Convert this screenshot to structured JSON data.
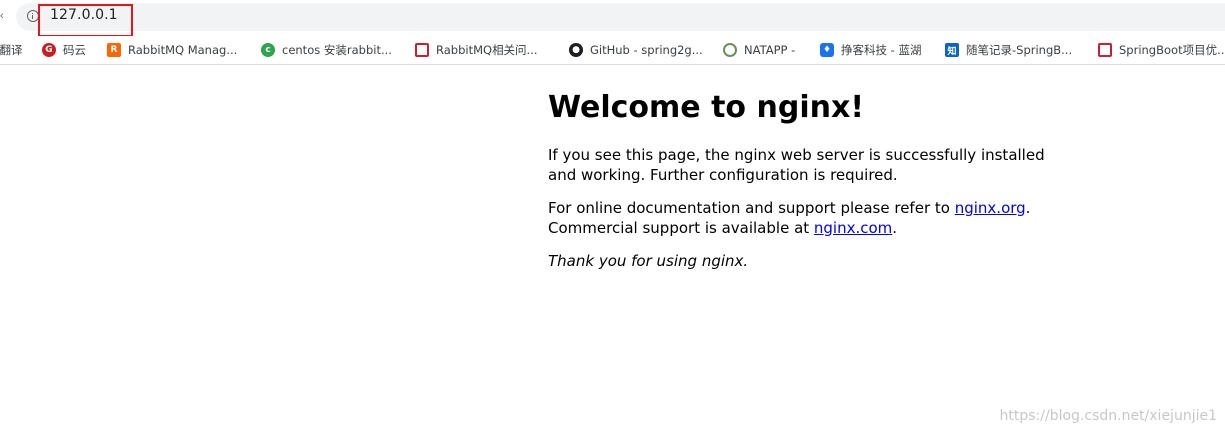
{
  "browser": {
    "back_glyph": "‹",
    "url": "127.0.0.1",
    "info_icon": "info-icon",
    "accent_highlight": "#e3171c"
  },
  "bookmarks": [
    {
      "label": "注翻译",
      "icon": "none"
    },
    {
      "label": "码云",
      "icon": "gitee-icon",
      "glyph": "G"
    },
    {
      "label": "RabbitMQ Manag...",
      "icon": "rabbitmq-icon",
      "glyph": "R"
    },
    {
      "label": "centos 安装rabbit...",
      "icon": "centos-icon",
      "glyph": "c"
    },
    {
      "label": "RabbitMQ相关问...",
      "icon": "csdn-icon",
      "glyph": "C"
    },
    {
      "label": "GitHub - spring2g...",
      "icon": "github-icon",
      "glyph": "●"
    },
    {
      "label": "NATAPP -",
      "icon": "natapp-icon",
      "glyph": ""
    },
    {
      "label": "挣客科技 - 蓝湖",
      "icon": "lanhu-icon",
      "glyph": "♦"
    },
    {
      "label": "随笔记录-SpringB...",
      "icon": "zhihu-icon",
      "glyph": "知"
    },
    {
      "label": "SpringBoot项目优...",
      "icon": "csdn-icon",
      "glyph": "C"
    }
  ],
  "page": {
    "heading": "Welcome to nginx!",
    "para1": "If you see this page, the nginx web server is successfully installed and working. Further configuration is required.",
    "para2_prefix": "For online documentation and support please refer to ",
    "link1": "nginx.org",
    "para2_mid": ".",
    "para2_line2": "Commercial support is available at ",
    "link2": "nginx.com",
    "para2_end": ".",
    "thanks": "Thank you for using nginx."
  },
  "watermark": "https://blog.csdn.net/xiejunjie1"
}
